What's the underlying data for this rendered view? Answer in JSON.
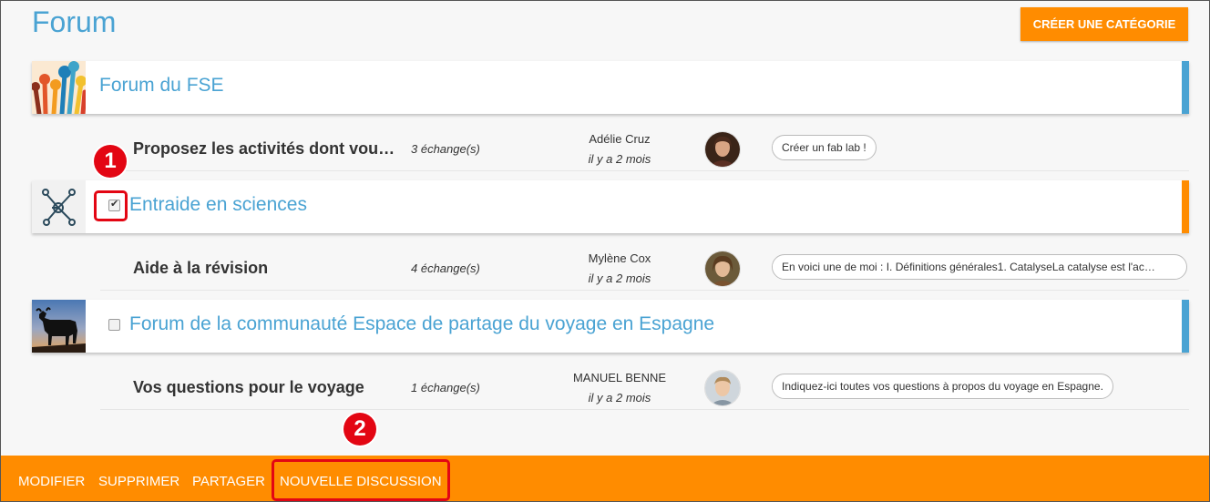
{
  "page": {
    "title": "Forum"
  },
  "header": {
    "create_category_label": "Créer une catégorie"
  },
  "categories": [
    {
      "name": "Forum du FSE",
      "accent_color": "#4aa3d3",
      "icon": "raised-hands-image",
      "checked": false,
      "discussion": {
        "topic": "Proposez les activités dont vous a…",
        "count": "3 échange(s)",
        "author": "Adélie Cruz",
        "date": "il y a 2 mois",
        "last_message": "Créer un fab lab !"
      }
    },
    {
      "name": "Entraide en sciences",
      "accent_color": "#ff8c00",
      "icon": "molecule-icon",
      "checked": true,
      "discussion": {
        "topic": "Aide à la révision",
        "count": "4 échange(s)",
        "author": "Mylène Cox",
        "date": "il y a 2 mois",
        "last_message": "En voici une de moi : I. Définitions générales1. CatalyseLa catalyse est l'ac…"
      }
    },
    {
      "name": "Forum de la communauté Espace de partage du voyage en Espagne",
      "accent_color": "#4aa3d3",
      "icon": "bull-silhouette-image",
      "checked": false,
      "discussion": {
        "topic": "Vos questions pour le voyage",
        "count": "1 échange(s)",
        "author": "MANUEL BENNE",
        "date": "il y a 2 mois",
        "last_message": "Indiquez-ici toutes vos questions à propos du voyage en Espagne."
      }
    }
  ],
  "annotations": {
    "step1": "1",
    "step2": "2"
  },
  "toolbar": {
    "modify": "Modifier",
    "delete": "Supprimer",
    "share": "Partager",
    "new_discussion": "Nouvelle discussion"
  },
  "colors": {
    "accent_orange": "#ff8c00",
    "title_blue": "#4aa3d3",
    "annotation_red": "#e30613"
  }
}
